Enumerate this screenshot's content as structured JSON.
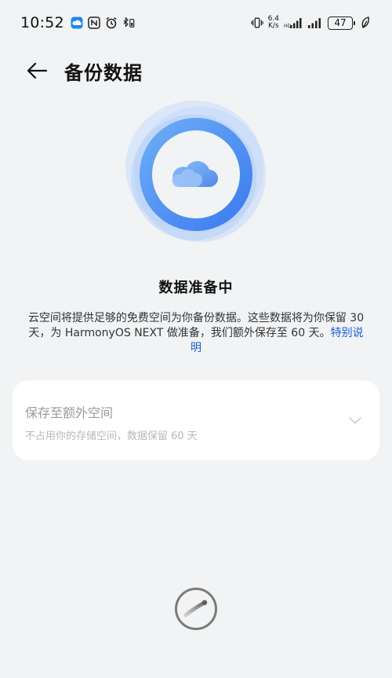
{
  "status_bar": {
    "time": "10:52",
    "net_speed_value": "6.4",
    "net_speed_unit": "K/s",
    "battery": "47"
  },
  "header": {
    "title": "备份数据"
  },
  "main": {
    "status_heading": "数据准备中",
    "description_text": "云空间将提供足够的免费空间为你备份数据。这些数据将为你保留 30 天，为 HarmonyOS NEXT 做准备，我们额外保存至 60 天。",
    "description_link": "特别说明"
  },
  "card": {
    "title": "保存至额外空间",
    "subtitle": "不占用你的存储空间，数据保留 60 天"
  },
  "colors": {
    "accent": "#3d8bf2",
    "link": "#1a5fd6",
    "background": "#f1f3f5"
  }
}
